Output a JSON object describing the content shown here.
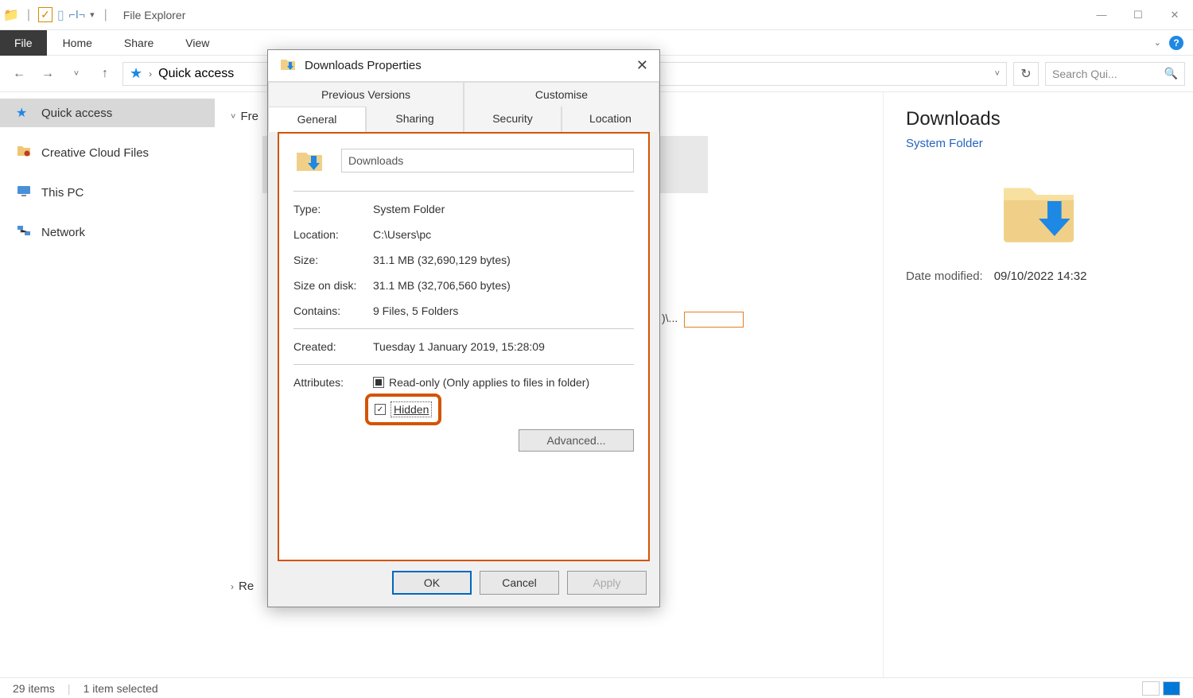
{
  "window": {
    "title": "File Explorer",
    "win_min": "—",
    "win_max": "☐",
    "win_close": "✕"
  },
  "ribbon": {
    "file": "File",
    "home": "Home",
    "share": "Share",
    "view": "View"
  },
  "nav": {
    "back": "←",
    "forward": "→",
    "up": "↑",
    "crumb_item": "Quick access",
    "crumb_arrow": "›",
    "refresh": "↻",
    "search_placeholder": "Search Qui..."
  },
  "sidebar": {
    "items": [
      {
        "label": "Quick access",
        "icon": "★",
        "color": "#1e88e5",
        "active": true
      },
      {
        "label": "Creative Cloud Files",
        "icon": "📁",
        "color": "#e8c060"
      },
      {
        "label": "This PC",
        "icon": "💻",
        "color": "#4a90d9"
      },
      {
        "label": "Network",
        "icon": "🔷",
        "color": "#4a90d9"
      }
    ]
  },
  "content": {
    "freq_label": "Fre",
    "recent_label": "Re",
    "path_frag": ")\\..."
  },
  "details": {
    "title": "Downloads",
    "type": "System Folder",
    "date_label": "Date modified:",
    "date_value": "09/10/2022 14:32"
  },
  "status": {
    "items": "29 items",
    "selected": "1 item selected"
  },
  "dialog": {
    "title": "Downloads Properties",
    "close": "✕",
    "tabs_row1": [
      "Previous Versions",
      "Customise"
    ],
    "tabs_row2": [
      "General",
      "Sharing",
      "Security",
      "Location"
    ],
    "active_tab": "General",
    "name_value": "Downloads",
    "props": {
      "type": {
        "k": "Type:",
        "v": "System Folder"
      },
      "location": {
        "k": "Location:",
        "v": "C:\\Users\\pc"
      },
      "size": {
        "k": "Size:",
        "v": "31.1 MB (32,690,129 bytes)"
      },
      "size_disk": {
        "k": "Size on disk:",
        "v": "31.1 MB (32,706,560 bytes)"
      },
      "contains": {
        "k": "Contains:",
        "v": "9 Files, 5 Folders"
      },
      "created": {
        "k": "Created:",
        "v": "Tuesday 1 January 2019, 15:28:09"
      }
    },
    "attributes": {
      "label": "Attributes:",
      "readonly": "Read-only (Only applies to files in folder)",
      "hidden": "Hidden",
      "advanced": "Advanced..."
    },
    "buttons": {
      "ok": "OK",
      "cancel": "Cancel",
      "apply": "Apply"
    }
  }
}
